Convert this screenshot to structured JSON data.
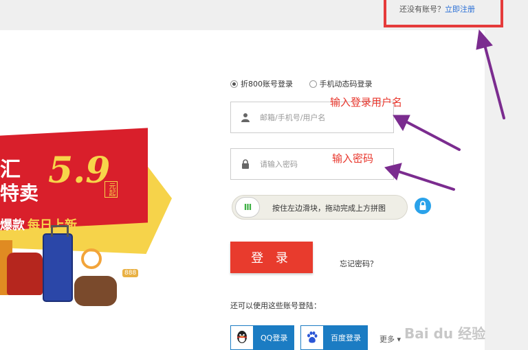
{
  "header": {
    "no_account_text": "还没有账号？",
    "register_link": "立即注册"
  },
  "banner": {
    "title_line1": "汇",
    "title_line2": "特卖",
    "price": "5.9",
    "price_unit": "元起",
    "slogan_a": "爆款",
    "slogan_b": "每日上新",
    "tag": "888"
  },
  "login": {
    "tabs": [
      {
        "label": "折800账号登录",
        "selected": true
      },
      {
        "label": "手机动态码登录",
        "selected": false
      }
    ],
    "username_placeholder": "邮箱/手机号/用户名",
    "username_annotation": "输入登录用户名",
    "password_placeholder": "请输入密码",
    "password_annotation": "输入密码",
    "slider_handle": "III",
    "slider_text": "按住左边滑块，拖动完成上方拼图",
    "login_button": "登 录",
    "forgot_password": "忘记密码？",
    "other_login_label": "还可以使用这些账号登陆：",
    "social": [
      {
        "label": "QQ登录",
        "icon": "qq-penguin-icon"
      },
      {
        "label": "百度登录",
        "icon": "baidu-paw-icon"
      }
    ],
    "more": "更多"
  },
  "watermark": "Bai du 经验",
  "colors": {
    "accent_red": "#e83b2d",
    "link_blue": "#2a6fd6",
    "social_blue": "#1b7cc3",
    "annotation_purple": "#7b2c8f"
  }
}
